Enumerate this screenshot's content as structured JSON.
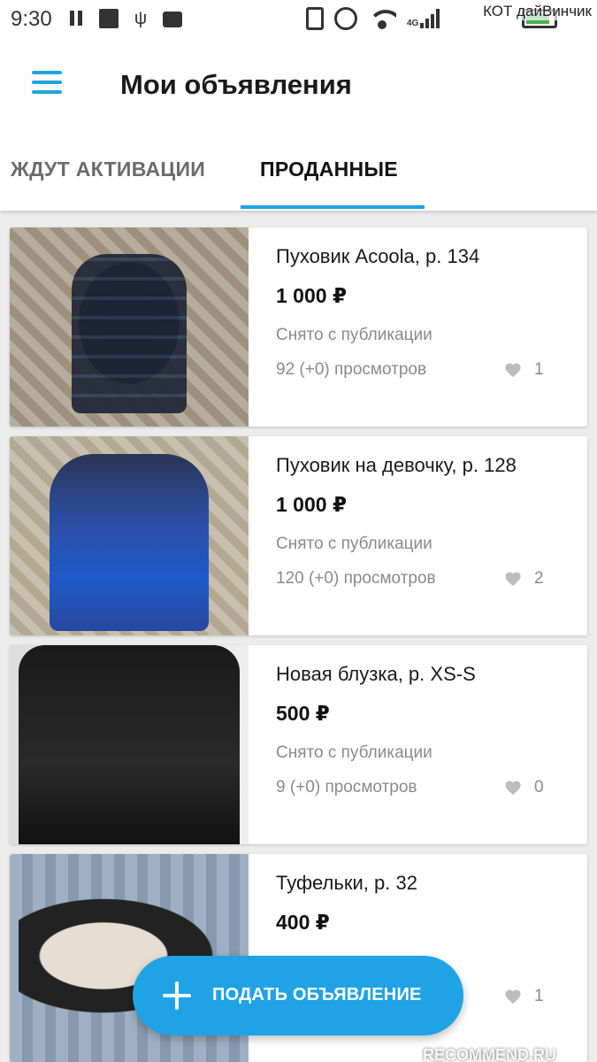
{
  "status_bar": {
    "time": "9:30",
    "network": "4G",
    "watermark": "КОТ дайВинчик"
  },
  "header": {
    "title": "Мои объявления"
  },
  "tabs": [
    {
      "label": "ЖДУТ АКТИВАЦИИ",
      "active": false
    },
    {
      "label": "ПРОДАННЫЕ",
      "active": true
    }
  ],
  "listings": [
    {
      "title": "Пуховик Acoola, р. 134",
      "price": "1 000 ₽",
      "status": "Снято с публикации",
      "views": "92 (+0) просмотров",
      "favorites": "1"
    },
    {
      "title": "Пуховик на девочку, р. 128",
      "price": "1 000 ₽",
      "status": "Снято с публикации",
      "views": "120 (+0) просмотров",
      "favorites": "2"
    },
    {
      "title": "Новая блузка, р. XS-S",
      "price": "500 ₽",
      "status": "Снято с публикации",
      "views": "9 (+0) просмотров",
      "favorites": "0"
    },
    {
      "title": "Туфельки, р. 32",
      "price": "400 ₽",
      "status": "",
      "views": "",
      "favorites": "1"
    }
  ],
  "fab": {
    "label": "ПОДАТЬ ОБЪЯВЛЕНИЕ"
  },
  "footer_watermark": "RECOMMEND.RU",
  "colors": {
    "accent": "#1fa3e6",
    "text_secondary": "#8a8a8a",
    "background": "#ececec"
  }
}
